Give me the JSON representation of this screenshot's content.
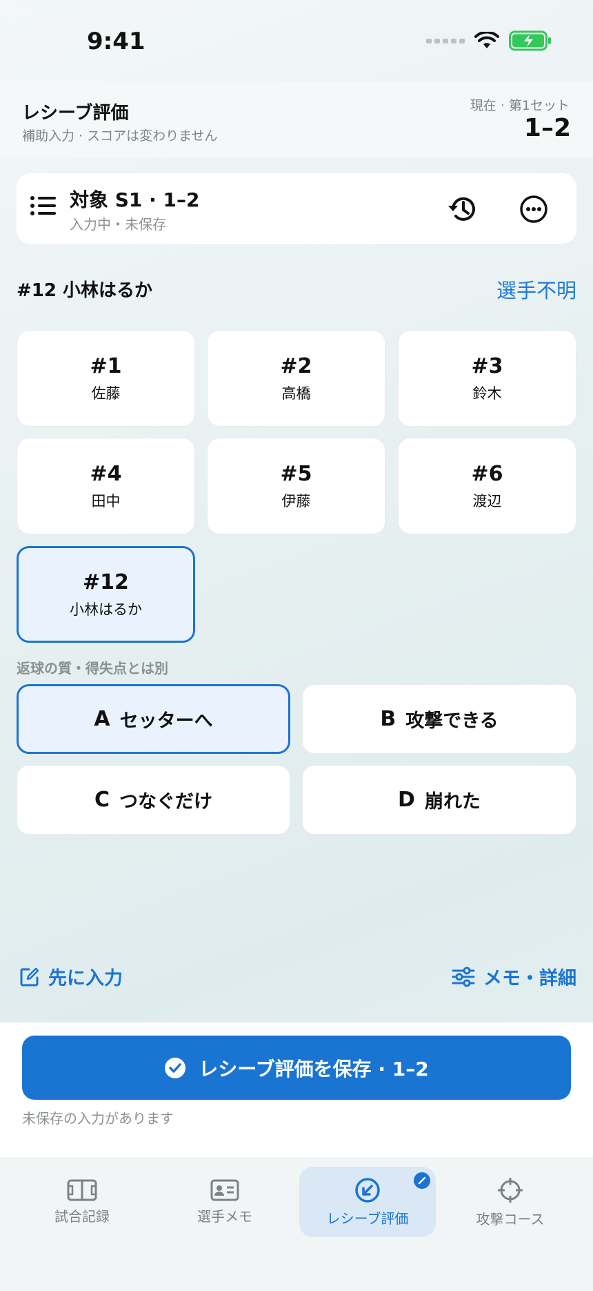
{
  "status_bar": {
    "time": "9:41",
    "icons": [
      "signal-dots-icon",
      "wifi-icon",
      "battery-charging-icon"
    ]
  },
  "header": {
    "title": "レシーブ評価",
    "subtitle": "補助入力 · スコアは変わりません",
    "set_label": "現在 · 第1セット",
    "score": "1–2"
  },
  "target": {
    "title": "対象 S1 · 1–2",
    "subtitle": "入力中・未保存",
    "icons": [
      "list-icon",
      "history-icon",
      "more-icon"
    ]
  },
  "player_section": {
    "selected_label": "#12 小林はるか",
    "unknown_link": "選手不明",
    "players": [
      {
        "number": "#1",
        "name": "佐藤"
      },
      {
        "number": "#2",
        "name": "高橋"
      },
      {
        "number": "#3",
        "name": "鈴木"
      },
      {
        "number": "#4",
        "name": "田中"
      },
      {
        "number": "#5",
        "name": "伊藤"
      },
      {
        "number": "#6",
        "name": "渡辺"
      },
      {
        "number": "#12",
        "name": "小林はるか"
      }
    ],
    "selected_index": 6
  },
  "quality_section": {
    "label": "返球の質・得失点とは別",
    "options": [
      {
        "letter": "A",
        "text": "セッターへ"
      },
      {
        "letter": "B",
        "text": "攻撃できる"
      },
      {
        "letter": "C",
        "text": "つなぐだけ"
      },
      {
        "letter": "D",
        "text": "崩れた"
      }
    ],
    "selected_index": 0
  },
  "links": {
    "pre_input": "先に入力",
    "memo_detail": "メモ・詳細"
  },
  "save": {
    "button_label": "レシーブ評価を保存 · 1–2",
    "unsaved_note": "未保存の入力があります"
  },
  "tabs": [
    {
      "label": "試合記録",
      "icon": "court-icon"
    },
    {
      "label": "選手メモ",
      "icon": "id-card-icon"
    },
    {
      "label": "レシーブ評価",
      "icon": "receive-icon",
      "active": true,
      "badge_icon": "edit-badge-icon"
    },
    {
      "label": "攻撃コース",
      "icon": "crosshair-icon"
    }
  ],
  "colors": {
    "accent": "#1a74d2",
    "selected_bg": "#eaf3fd",
    "battery": "#34c759"
  }
}
